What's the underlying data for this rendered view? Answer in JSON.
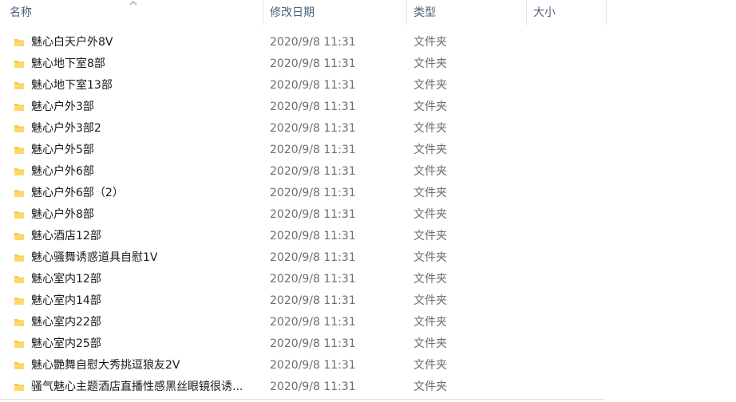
{
  "columns": {
    "name": "名称",
    "date_modified": "修改日期",
    "type": "类型",
    "size": "大小"
  },
  "folder_icon_color": "#f3c847",
  "rows": [
    {
      "name": "魅心白天户外8V",
      "date": "2020/9/8 11:31",
      "type": "文件夹"
    },
    {
      "name": "魅心地下室8部",
      "date": "2020/9/8 11:31",
      "type": "文件夹"
    },
    {
      "name": "魅心地下室13部",
      "date": "2020/9/8 11:31",
      "type": "文件夹"
    },
    {
      "name": "魅心户外3部",
      "date": "2020/9/8 11:31",
      "type": "文件夹"
    },
    {
      "name": "魅心户外3部2",
      "date": "2020/9/8 11:31",
      "type": "文件夹"
    },
    {
      "name": "魅心户外5部",
      "date": "2020/9/8 11:31",
      "type": "文件夹"
    },
    {
      "name": "魅心户外6部",
      "date": "2020/9/8 11:31",
      "type": "文件夹"
    },
    {
      "name": "魅心户外6部（2）",
      "date": "2020/9/8 11:31",
      "type": "文件夹"
    },
    {
      "name": "魅心户外8部",
      "date": "2020/9/8 11:31",
      "type": "文件夹"
    },
    {
      "name": "魅心酒店12部",
      "date": "2020/9/8 11:31",
      "type": "文件夹"
    },
    {
      "name": "魅心骚舞诱惑道具自慰1V",
      "date": "2020/9/8 11:31",
      "type": "文件夹"
    },
    {
      "name": "魅心室内12部",
      "date": "2020/9/8 11:31",
      "type": "文件夹"
    },
    {
      "name": "魅心室内14部",
      "date": "2020/9/8 11:31",
      "type": "文件夹"
    },
    {
      "name": "魅心室内22部",
      "date": "2020/9/8 11:31",
      "type": "文件夹"
    },
    {
      "name": "魅心室内25部",
      "date": "2020/9/8 11:31",
      "type": "文件夹"
    },
    {
      "name": "魅心艷舞自慰大秀挑逗狼友2V",
      "date": "2020/9/8 11:31",
      "type": "文件夹"
    },
    {
      "name": "骚气魅心主题酒店直播性感黑丝眼镜很诱...",
      "date": "2020/9/8 11:31",
      "type": "文件夹"
    }
  ]
}
